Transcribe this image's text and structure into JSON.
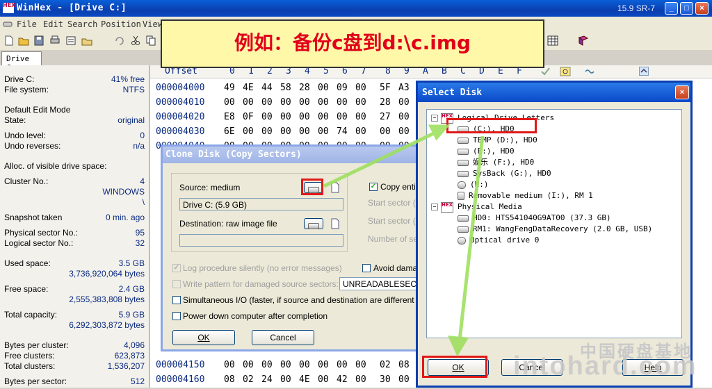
{
  "window": {
    "title": "WinHex - [Drive C:]",
    "version": "15.9 SR-7",
    "logo_text": "HEX",
    "controls": {
      "minimize": "_",
      "maximize": "□",
      "close": "×"
    }
  },
  "menu": [
    "File",
    "Edit",
    "Search",
    "Position",
    "View"
  ],
  "tab": {
    "label": "Drive C:"
  },
  "banner": {
    "text": "例如：备份c盘到d:\\c.img"
  },
  "info": {
    "drive_label": "Drive C:",
    "drive_free": "41% free",
    "fs_label": "File system:",
    "fs_value": "NTFS",
    "edit_mode_label": "Default Edit Mode",
    "state_label": "State:",
    "state_value": "original",
    "undo_level_label": "Undo level:",
    "undo_level_value": "0",
    "undo_rev_label": "Undo reverses:",
    "undo_rev_value": "n/a",
    "alloc_label": "Alloc. of visible drive space:",
    "cluster_label": "Cluster No.:",
    "cluster_value": "4",
    "cluster_path1": "WINDOWS",
    "cluster_path2": "\\",
    "snapshot_label": "Snapshot taken",
    "snapshot_value": "0 min. ago",
    "phys_label": "Physical sector No.:",
    "phys_value": "95",
    "log_label": "Logical sector No.:",
    "log_value": "32",
    "used_label": "Used space:",
    "used_value": "3.5 GB",
    "used_bytes": "3,736,920,064 bytes",
    "free_label": "Free space:",
    "free_value": "2.4 GB",
    "free_bytes": "2,555,383,808 bytes",
    "total_label": "Total capacity:",
    "total_value": "5.9 GB",
    "total_bytes": "6,292,303,872 bytes",
    "bpc_label": "Bytes per cluster:",
    "bpc_value": "4,096",
    "fc_label": "Free clusters:",
    "fc_value": "623,873",
    "tc_label": "Total clusters:",
    "tc_value": "1,536,207",
    "bps_label": "Bytes per sector:",
    "bps_value": "512"
  },
  "hex": {
    "offset_header": "Offset",
    "columns": [
      "0",
      "1",
      "2",
      "3",
      "4",
      "5",
      "6",
      "7",
      "8",
      "9",
      "A",
      "B",
      "C",
      "D",
      "E",
      "F"
    ],
    "rows": [
      {
        "offset": "000004000",
        "bytes": [
          "49",
          "4E",
          "44",
          "58",
          "28",
          "00",
          "09",
          "00",
          "",
          "5F",
          "A3"
        ]
      },
      {
        "offset": "000004010",
        "bytes": [
          "00",
          "00",
          "00",
          "00",
          "00",
          "00",
          "00",
          "00",
          "",
          "28",
          "00"
        ]
      },
      {
        "offset": "000004020",
        "bytes": [
          "E8",
          "0F",
          "00",
          "00",
          "00",
          "00",
          "00",
          "00",
          "",
          "27",
          "00"
        ]
      },
      {
        "offset": "000004030",
        "bytes": [
          "6E",
          "00",
          "00",
          "00",
          "00",
          "00",
          "74",
          "00",
          "",
          "00",
          "00"
        ]
      },
      {
        "offset": "000004040",
        "bytes": [
          "00",
          "00",
          "00",
          "00",
          "00",
          "00",
          "00",
          "00",
          "",
          "00",
          "00"
        ]
      },
      {
        "offset": "000004150",
        "bytes": [
          "00",
          "00",
          "00",
          "00",
          "00",
          "00",
          "00",
          "00",
          "",
          "02",
          "08"
        ]
      },
      {
        "offset": "000004160",
        "bytes": [
          "08",
          "02",
          "24",
          "00",
          "4E",
          "00",
          "42",
          "00",
          "",
          "30",
          "00"
        ]
      }
    ]
  },
  "clone": {
    "title": "Clone Disk (Copy Sectors)",
    "source_label": "Source: medium",
    "source_value": "Drive C: (5.9 GB)",
    "dest_label": "Destination: raw image file",
    "dest_value": "",
    "copy_entire_label": "Copy entire",
    "start_sector_src": "Start sector (so",
    "start_sector_dst": "Start sector (de",
    "num_sectors": "Number of sec",
    "log_silently": "Log procedure silently (no error messages)",
    "avoid_damage": "Avoid damag",
    "write_pattern": "Write pattern for damaged source sectors:",
    "pattern_value": "UNREADABLESECTO",
    "simultaneous": "Simultaneous I/O (faster, if source and destination are different physical",
    "power_down": "Power down computer after completion",
    "ok": "OK",
    "cancel": "Cancel"
  },
  "select": {
    "title": "Select Disk",
    "close": "×",
    "hex_icon": "HEX",
    "logical_header": "Logical Drive Letters",
    "logical": [
      "(C:), HD0",
      "TEMP (D:), HD0",
      "(E:), HD0",
      "娱乐 (F:), HD0",
      "SysBack (G:), HD0",
      "(H:)",
      "Removable medium (I:), RM 1"
    ],
    "physical_header": "Physical Media",
    "physical": [
      "HD0: HTS541040G9AT00 (37.3 GB)",
      "RM1: WangFengDataRecovery (2.0 GB, USB)",
      "Optical drive 0"
    ],
    "ok": "OK",
    "cancel": "Cancel",
    "help": "Help"
  },
  "watermark": {
    "line1": "中国硬盘基地",
    "line2": "intohard.com"
  },
  "colors": {
    "annotation_red": "#e01818",
    "arrow_green": "#9fe060",
    "banner_bg": "#fff8a8"
  }
}
